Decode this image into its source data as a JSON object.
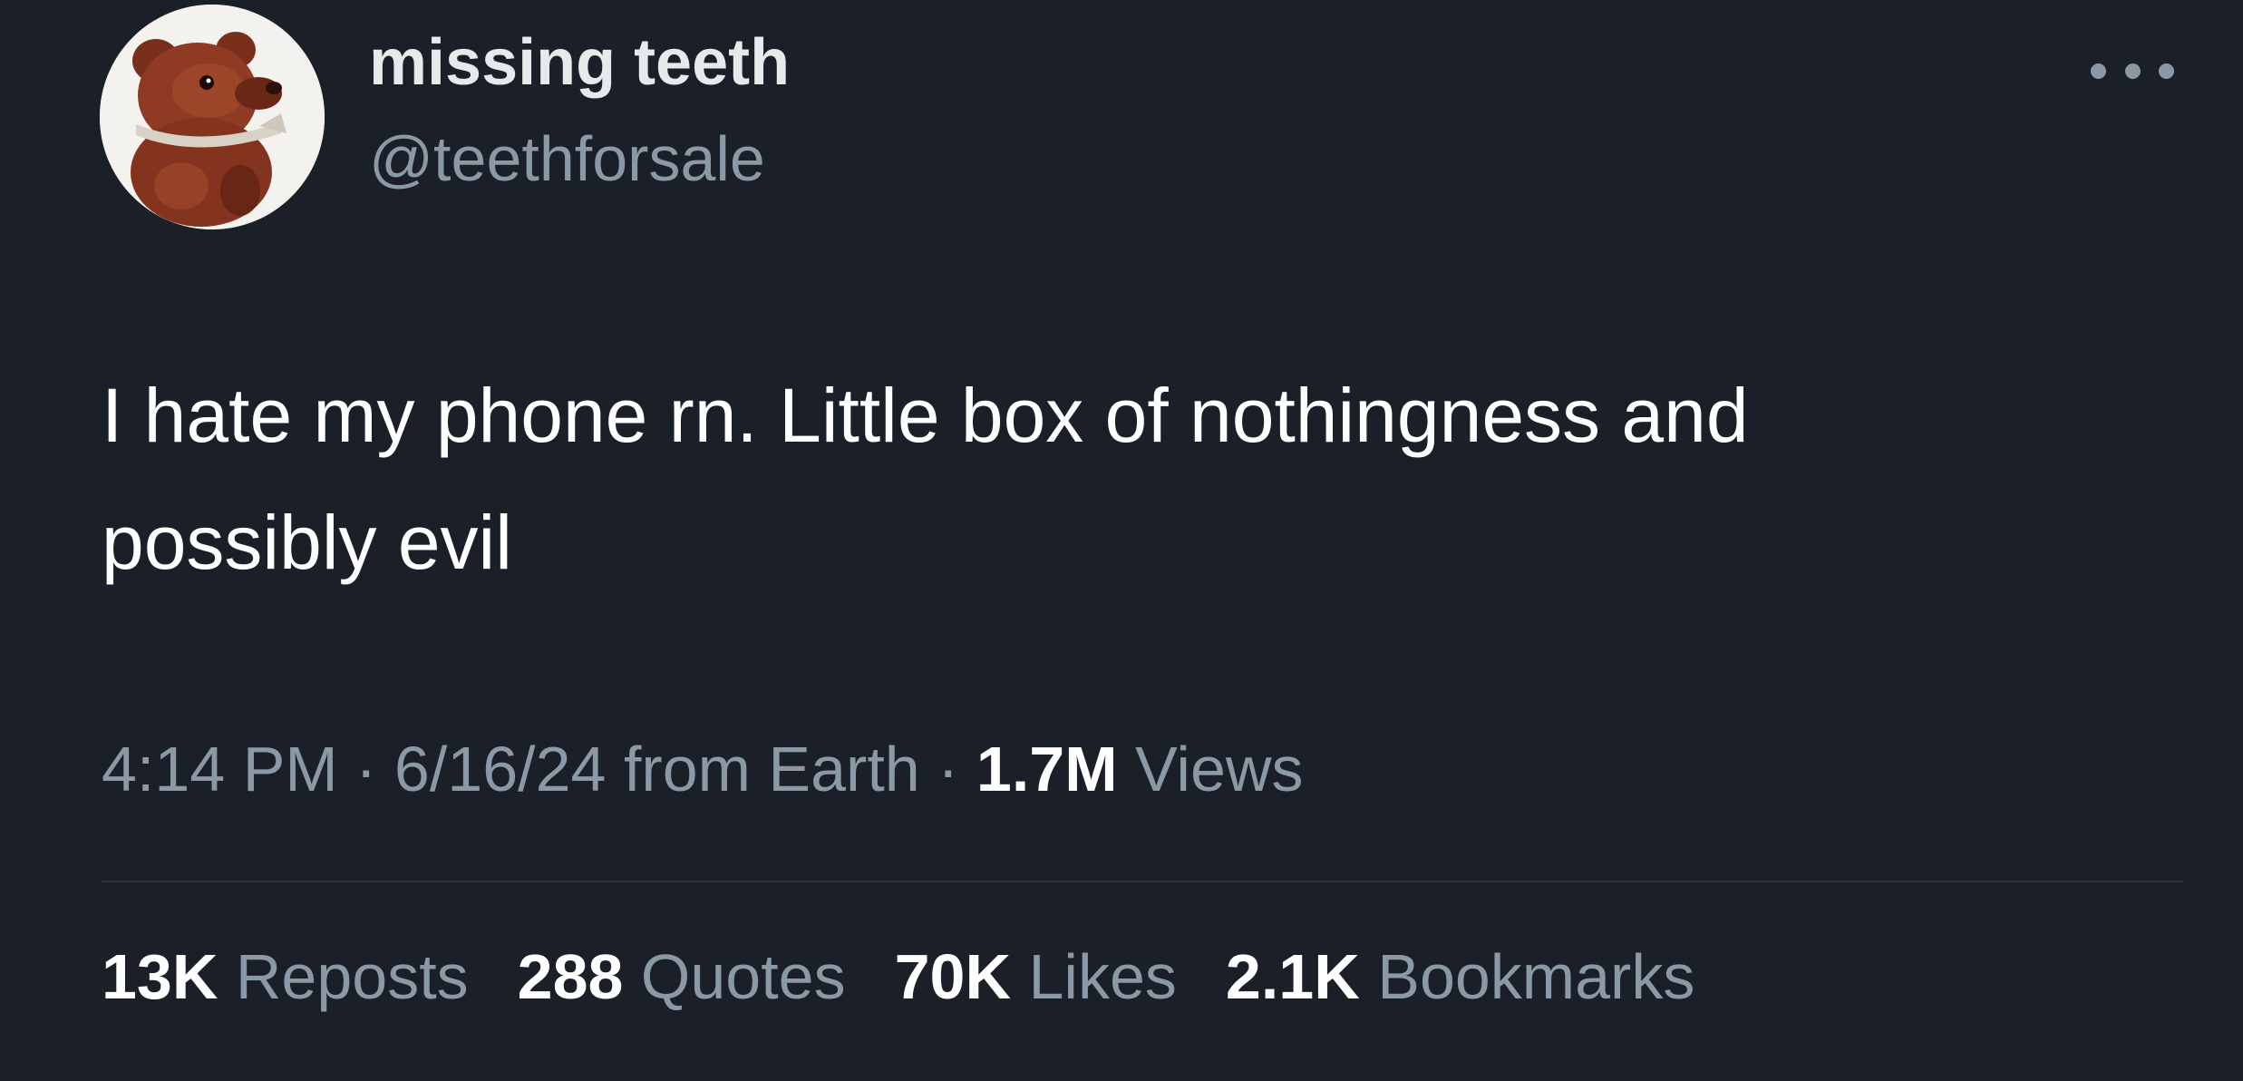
{
  "author": {
    "display_name": "missing teeth",
    "handle": "@teethforsale",
    "avatar_icon": "teddy-bear-avatar-icon"
  },
  "more_icon": "more-horizontal-icon",
  "tweet": {
    "text": "I hate my phone rn. Little box of nothingness and\npossibly evil"
  },
  "meta": {
    "time": "4:14 PM",
    "separator": " · ",
    "date": "6/16/24",
    "source": "from Earth",
    "views_count": "1.7M",
    "views_label": "Views"
  },
  "stats": [
    {
      "count": "13K",
      "label": "Reposts"
    },
    {
      "count": "288",
      "label": "Quotes"
    },
    {
      "count": "70K",
      "label": "Likes"
    },
    {
      "count": "2.1K",
      "label": "Bookmarks"
    }
  ],
  "colors": {
    "background": "#1a1f28",
    "primary_text": "#ffffff",
    "secondary_text": "#8b98a5",
    "divider": "#2f3540"
  }
}
